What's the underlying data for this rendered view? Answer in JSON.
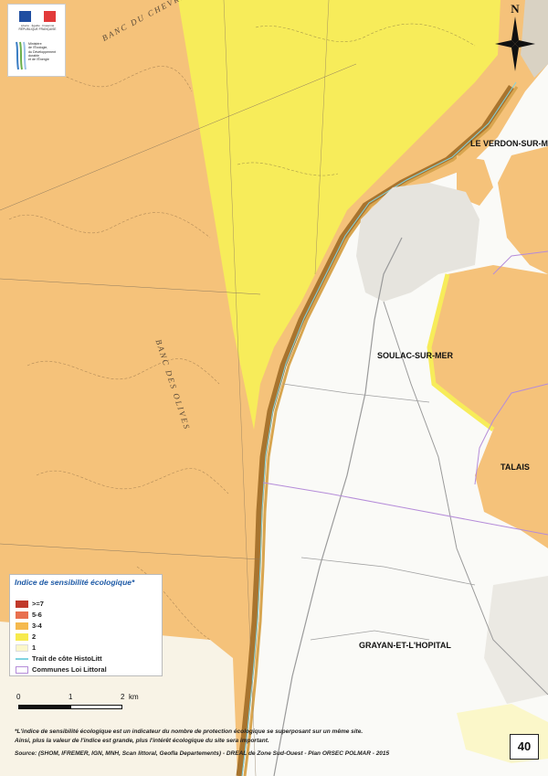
{
  "logo": {
    "motto": "Liberté · Égalité · Fraternité",
    "republic": "RÉPUBLIQUE FRANÇAISE",
    "ministry_lines": [
      "Ministère",
      "de l'Écologie,",
      "du Développement",
      "durable",
      "et de l'Énergie"
    ]
  },
  "north_label": "N",
  "places": {
    "le_verdon": "LE VERDON-SUR-MER",
    "soulac": "SOULAC-SUR-MER",
    "talais": "TALAIS",
    "grayan": "GRAYAN-ET-L'HOPITAL"
  },
  "banks": {
    "chevrier": "BANC DU CHEVRIER",
    "olives": "BANC DES OLIVES"
  },
  "legend": {
    "title": "Indice de sensibilité écologique*",
    "items": [
      {
        "label": ">=7",
        "color": "#c0392b"
      },
      {
        "label": "5-6",
        "color": "#e8704f"
      },
      {
        "label": "3-4",
        "color": "#f5b94e"
      },
      {
        "label": "2",
        "color": "#f7ea4d"
      },
      {
        "label": "1",
        "color": "#fbf7c9"
      }
    ],
    "lines": [
      {
        "label": "Trait de côte HistoLitt",
        "color": "#7fd3e0"
      },
      {
        "label": "Communes Loi Littoral",
        "color": "#b58cd9"
      }
    ]
  },
  "scale": {
    "label_0": "0",
    "label_1": "1",
    "label_2": "2",
    "unit": "km"
  },
  "notes": {
    "line1": "*L'indice de sensibilité écologique est un indicateur du nombre de protection écologique se superposant sur un même site.",
    "line2": "Ainsi, plus la valeur de l'indice est grande, plus l'intérêt écologique du site sera important.",
    "source": "Source: (SHOM, IFREMER, IGN, MNH, Scan littoral, Geofla Departements) - DREAL de Zone Sud-Ouest - Plan ORSEC POLMAR - 2015"
  },
  "page_number": "40"
}
